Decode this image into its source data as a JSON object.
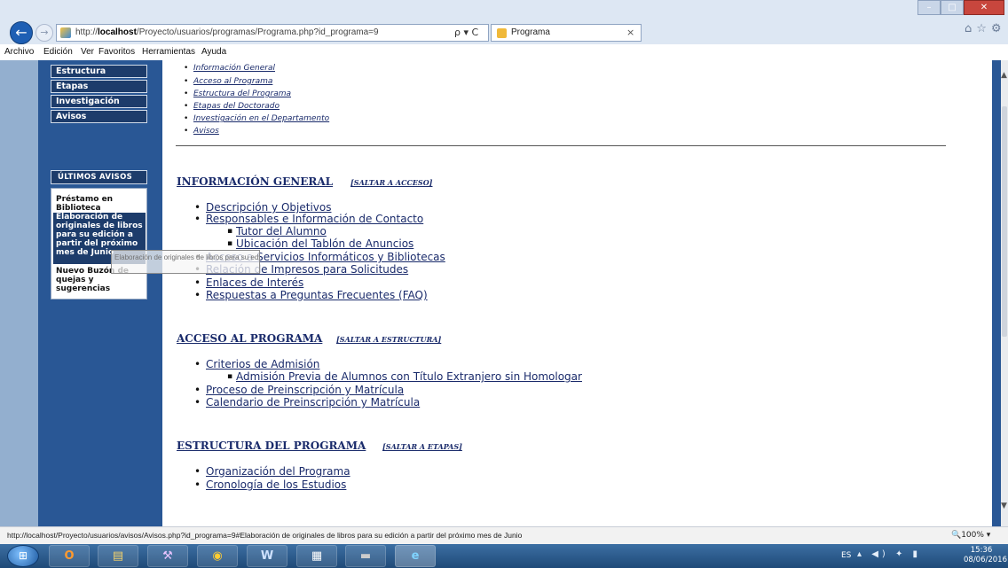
{
  "browser": {
    "url_prefix": "http://",
    "url_host": "localhost",
    "url_path": "/Proyecto/usuarios/programas/Programa.php?id_programa=9",
    "search_tools": "ρ ▾ C",
    "tab_title": "Programa",
    "tab_close": "×",
    "back": "←",
    "forward": "→",
    "right_icons": "⌂☆⚙",
    "win_min": "–",
    "win_max": "□",
    "win_close": "✕"
  },
  "menu": [
    "Archivo",
    "Edición",
    "Ver",
    "Favoritos",
    "Herramientas",
    "Ayuda"
  ],
  "sidebar": {
    "nav": [
      "Estructura",
      "Etapas",
      "Investigación",
      "Avisos"
    ],
    "avisos_header": "ÚLTIMOS AVISOS",
    "avisos": [
      "Préstamo en Biblioteca",
      "Elaboración de originales de libros para su edición a partir del próximo mes de Junio",
      "Nuevo Buzón de quejas y sugerencias"
    ],
    "tooltip": "Elaboración de originales de libros para su edición a partir del próximo mes de Junio"
  },
  "toc": [
    "Información General",
    "Acceso al Programa",
    "Estructura del Programa",
    "Etapas del Doctorado",
    "Investigación en el Departamento",
    "Avisos"
  ],
  "sections": {
    "info": {
      "title": "INFORMACIÓN GENERAL",
      "skip": "[SALTAR A ACCESO]",
      "items": [
        "Descripción y Objetivos",
        "Responsables e Información de Contacto",
        "Tutor del Alumno",
        "Ubicación del Tablón de Anuncios",
        "Acceso a Servicios Informáticos y Bibliotecas",
        "Relación de Impresos para Solicitudes",
        "Enlaces de Interés",
        "Respuestas a Preguntas Frecuentes (FAQ)"
      ]
    },
    "acceso": {
      "title": "ACCESO AL PROGRAMA",
      "skip": "[SALTAR A ESTRUCTURA]",
      "items": [
        "Criterios de Admisión",
        "Admisión Previa de Alumnos con Título Extranjero sin Homologar",
        "Proceso de Preinscripción y Matrícula",
        "Calendario de Preinscripción y Matrícula"
      ]
    },
    "estructura": {
      "title": "ESTRUCTURA DEL PROGRAMA",
      "skip": "[SALTAR A ETAPAS]",
      "items": [
        "Organización del Programa",
        "Cronología de los Estudios"
      ]
    }
  },
  "status": {
    "url": "http://localhost/Proyecto/usuarios/avisos/Avisos.php?id_programa=9#Elaboración de originales de libros para su edición a partir del próximo mes de Junio",
    "zoom": "🔍100%  ▾"
  },
  "taskbar": {
    "start": "⊞",
    "apps": [
      "O",
      "▤",
      "⚒",
      "◉",
      "W",
      "▦",
      "▬",
      "e"
    ],
    "lang": "ES",
    "tray": "▴ ◀) ✦ ▮",
    "time": "15:36",
    "date": "08/06/2016"
  }
}
